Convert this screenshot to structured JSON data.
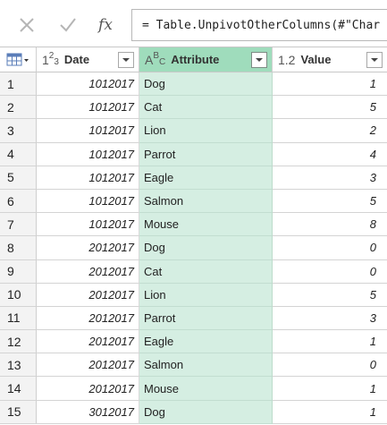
{
  "formula_bar": {
    "cancel_icon": "x-icon",
    "accept_icon": "check-icon",
    "fx_label": "fx",
    "formula": "= Table.UnpivotOtherColumns(#\"Char"
  },
  "columns": [
    {
      "type_icon": "whole-number-type-icon",
      "type_glyph": [
        "1",
        "2",
        "3"
      ],
      "title": "Date"
    },
    {
      "type_icon": "text-type-icon",
      "type_glyph": [
        "A",
        "B",
        "C"
      ],
      "title": "Attribute"
    },
    {
      "type_icon": "decimal-type-icon",
      "type_glyph": [
        "1.2"
      ],
      "title": "Value"
    }
  ],
  "colors": {
    "selected_header": "#9fdcbc",
    "selected_cells": "#d5eee2",
    "row_number_bg": "#f3f3f3"
  },
  "rows": [
    {
      "num": "1",
      "date": "1012017",
      "attribute": "Dog",
      "value": "1"
    },
    {
      "num": "2",
      "date": "1012017",
      "attribute": "Cat",
      "value": "5"
    },
    {
      "num": "3",
      "date": "1012017",
      "attribute": "Lion",
      "value": "2"
    },
    {
      "num": "4",
      "date": "1012017",
      "attribute": "Parrot",
      "value": "4"
    },
    {
      "num": "5",
      "date": "1012017",
      "attribute": "Eagle",
      "value": "3"
    },
    {
      "num": "6",
      "date": "1012017",
      "attribute": "Salmon",
      "value": "5"
    },
    {
      "num": "7",
      "date": "1012017",
      "attribute": "Mouse",
      "value": "8"
    },
    {
      "num": "8",
      "date": "2012017",
      "attribute": "Dog",
      "value": "0"
    },
    {
      "num": "9",
      "date": "2012017",
      "attribute": "Cat",
      "value": "0"
    },
    {
      "num": "10",
      "date": "2012017",
      "attribute": "Lion",
      "value": "5"
    },
    {
      "num": "11",
      "date": "2012017",
      "attribute": "Parrot",
      "value": "3"
    },
    {
      "num": "12",
      "date": "2012017",
      "attribute": "Eagle",
      "value": "1"
    },
    {
      "num": "13",
      "date": "2012017",
      "attribute": "Salmon",
      "value": "0"
    },
    {
      "num": "14",
      "date": "2012017",
      "attribute": "Mouse",
      "value": "1"
    },
    {
      "num": "15",
      "date": "3012017",
      "attribute": "Dog",
      "value": "1"
    }
  ]
}
